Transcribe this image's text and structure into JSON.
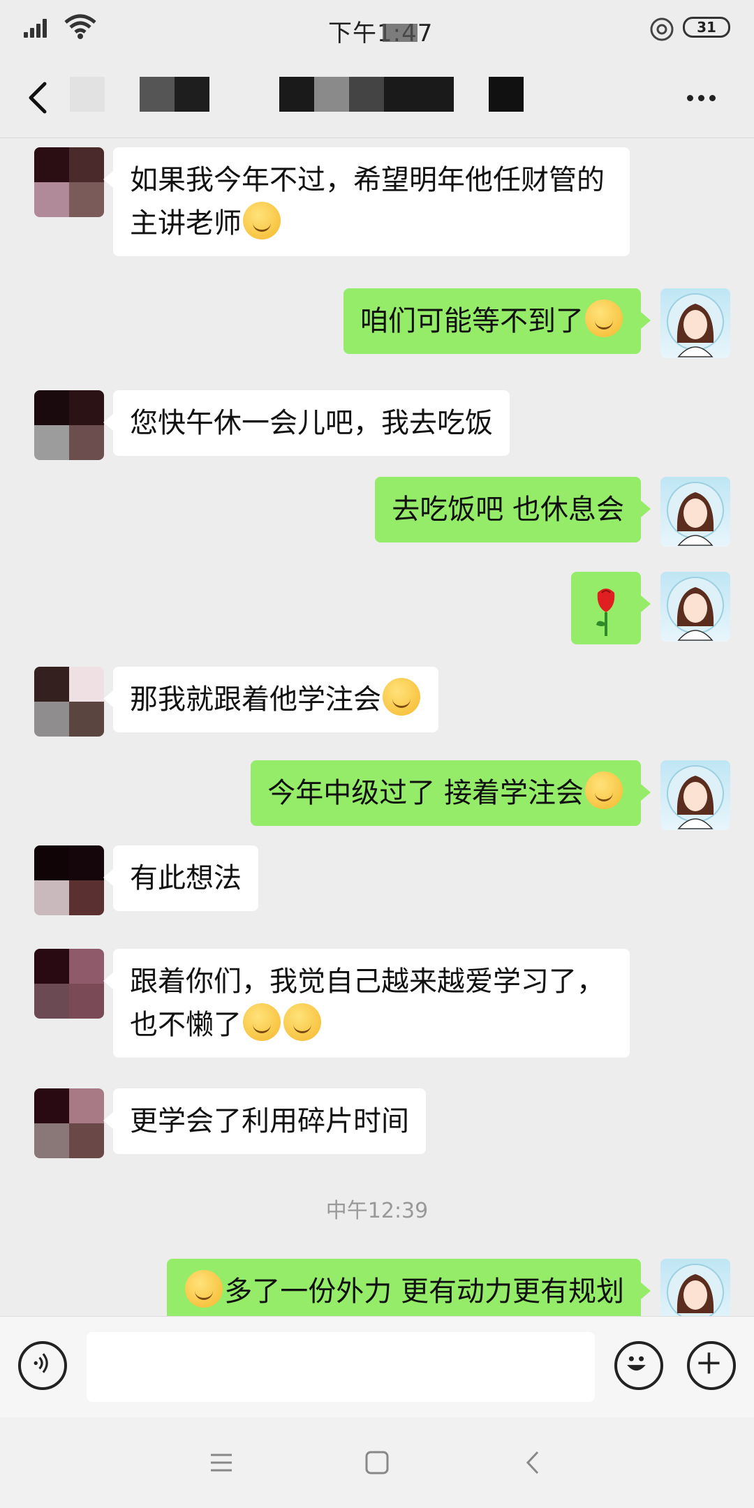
{
  "status_bar": {
    "time": "下午1:47",
    "battery": "31"
  },
  "nav": {
    "title": ""
  },
  "messages": [
    {
      "side": "other",
      "text": "如果我今年不过，希望明年他任财管的主讲老师",
      "emoji": "laugh-cry"
    },
    {
      "side": "self",
      "text": "咱们可能等不到了",
      "emoji": "blush"
    },
    {
      "side": "other",
      "text": "您快午休一会儿吧，我去吃饭",
      "emoji": ""
    },
    {
      "side": "self",
      "text": "去吃饭吧 也休息会",
      "emoji": ""
    },
    {
      "side": "self",
      "text": "",
      "emoji": "rose"
    },
    {
      "side": "other",
      "text": "那我就跟着他学注会",
      "emoji": "laugh-cry"
    },
    {
      "side": "self",
      "text": "今年中级过了 接着学注会",
      "emoji": "thinking"
    },
    {
      "side": "other",
      "text": "有此想法",
      "emoji": ""
    },
    {
      "side": "other",
      "text": "跟着你们，我觉自己越来越爱学习了，也不懒了",
      "emoji": "laugh-cry, thinking"
    },
    {
      "side": "other",
      "text": "更学会了利用碎片时间",
      "emoji": ""
    },
    {
      "side": "self",
      "text": "多了一份外力 更有动力更有规划",
      "emoji": "thinking"
    }
  ],
  "timestamp": "中午12:39",
  "input": {
    "value": "",
    "placeholder": ""
  },
  "colors": {
    "self_bubble": "#95ec69",
    "other_bubble": "#ffffff",
    "background": "#ededed"
  },
  "icons": [
    "back-icon",
    "more-icon",
    "voice-icon",
    "emoji-icon",
    "plus-icon",
    "menu-icon",
    "home-icon",
    "back-nav-icon"
  ]
}
